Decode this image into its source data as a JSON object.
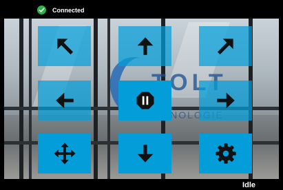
{
  "status": {
    "connection_label": "Connected",
    "connection_icon": "check-circle-icon",
    "connection_color": "#2fb24b",
    "state_label": "Idle"
  },
  "camera": {
    "logo_text": "TOLT",
    "logo_subtext": "HNOLOGIE"
  },
  "controls": {
    "accent_color": "#039ed9",
    "buttons": [
      {
        "icon": "arrow-up-left-icon"
      },
      {
        "icon": "arrow-up-icon"
      },
      {
        "icon": "arrow-up-right-icon"
      },
      {
        "icon": "arrow-left-icon"
      },
      {
        "icon": "stop-icon"
      },
      {
        "icon": "arrow-right-icon"
      },
      {
        "icon": "move-icon"
      },
      {
        "icon": "arrow-down-icon"
      },
      {
        "icon": "gear-icon"
      }
    ]
  }
}
